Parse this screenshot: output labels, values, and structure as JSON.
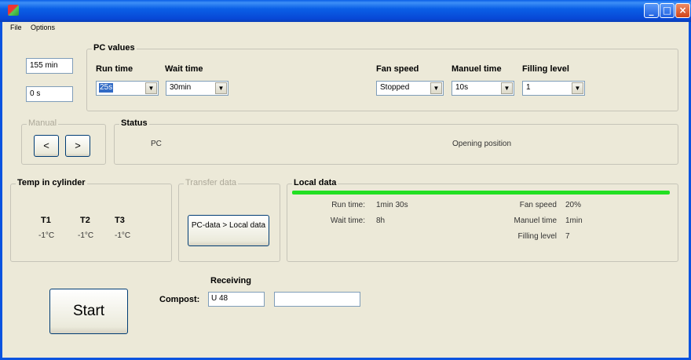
{
  "window": {
    "buttons": {
      "minimize": "_",
      "maximize": "□",
      "close": "×"
    }
  },
  "menu": {
    "file": "File",
    "options": "Options"
  },
  "left_boxes": {
    "minutes": "155 min",
    "seconds": "0 s"
  },
  "pc_values": {
    "title": "PC values",
    "run_time": {
      "label": "Run time",
      "value": "25s"
    },
    "wait_time": {
      "label": "Wait time",
      "value": "30min"
    },
    "fan_speed": {
      "label": "Fan speed",
      "value": "Stopped"
    },
    "manuel_time": {
      "label": "Manuel time",
      "value": "10s"
    },
    "filling_level": {
      "label": "Filling level",
      "value": "1"
    }
  },
  "manual": {
    "title": "Manual",
    "prev": "<",
    "next": ">"
  },
  "status": {
    "title": "Status",
    "mode": "PC",
    "position": "Opening position"
  },
  "temp": {
    "title": "Temp in cylinder",
    "sensors": [
      {
        "label": "T1",
        "value": "-1°C"
      },
      {
        "label": "T2",
        "value": "-1°C"
      },
      {
        "label": "T3",
        "value": "-1°C"
      }
    ]
  },
  "transfer": {
    "title": "Transfer data",
    "button": "PC-data > Local data"
  },
  "local_data": {
    "title": "Local data",
    "run_time": {
      "label": "Run time:",
      "value": "1min 30s"
    },
    "wait_time": {
      "label": "Wait time:",
      "value": "8h"
    },
    "fan_speed": {
      "label": "Fan speed",
      "value": "20%"
    },
    "manuel_time": {
      "label": "Manuel time",
      "value": "1min"
    },
    "filling_level": {
      "label": "Filling level",
      "value": "7"
    }
  },
  "start_button": "Start",
  "receiving": {
    "title": "Receiving",
    "compost_label": "Compost:",
    "compost_value": "U 48",
    "extra_value": ""
  },
  "colors": {
    "progress": "#22e022",
    "title_bar": "#0a5fe6"
  }
}
